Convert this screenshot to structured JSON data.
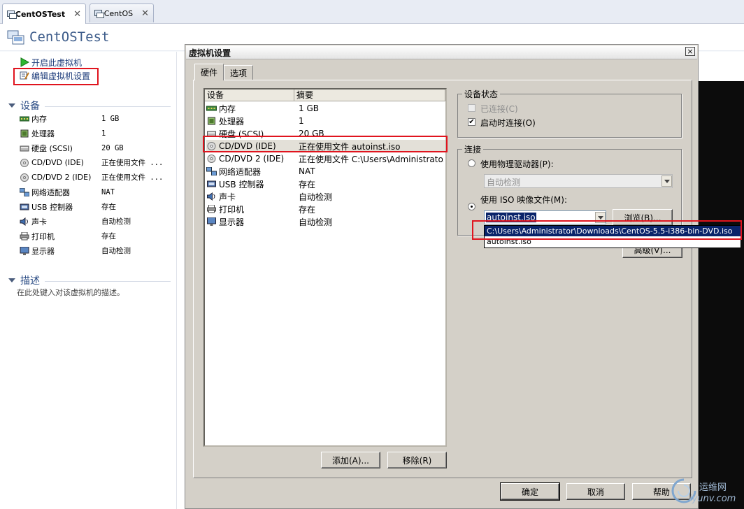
{
  "tabs": [
    {
      "label": "CentOSTest",
      "active": true
    },
    {
      "label": "CentOS",
      "active": false
    }
  ],
  "vm": {
    "title": "CentOSTest",
    "commands": {
      "power_on": "开启此虚拟机",
      "edit_settings": "编辑虚拟机设置"
    }
  },
  "devices_section": {
    "title": "设备",
    "items": [
      {
        "name": "内存",
        "value": "1 GB",
        "icon": "memory-icon"
      },
      {
        "name": "处理器",
        "value": "1",
        "icon": "cpu-icon"
      },
      {
        "name": "硬盘 (SCSI)",
        "value": "20 GB",
        "icon": "harddisk-icon"
      },
      {
        "name": "CD/DVD (IDE)",
        "value": "正在使用文件 ...",
        "icon": "cdrom-icon"
      },
      {
        "name": "CD/DVD 2 (IDE)",
        "value": "正在使用文件 ...",
        "icon": "cdrom-icon"
      },
      {
        "name": "网络适配器",
        "value": "NAT",
        "icon": "network-icon"
      },
      {
        "name": "USB 控制器",
        "value": "存在",
        "icon": "usb-icon"
      },
      {
        "name": "声卡",
        "value": "自动检测",
        "icon": "sound-icon"
      },
      {
        "name": "打印机",
        "value": "存在",
        "icon": "printer-icon"
      },
      {
        "name": "显示器",
        "value": "自动检测",
        "icon": "display-icon"
      }
    ]
  },
  "description_section": {
    "title": "描述",
    "placeholder": "在此处键入对该虚拟机的描述。"
  },
  "dialog": {
    "title": "虚拟机设置",
    "close": "×",
    "tabs": [
      "硬件",
      "选项"
    ],
    "list_headers": {
      "device": "设备",
      "summary": "摘要"
    },
    "devices": [
      {
        "name": "内存",
        "summary": "1 GB"
      },
      {
        "name": "处理器",
        "summary": "1"
      },
      {
        "name": "硬盘 (SCSI)",
        "summary": "20 GB"
      },
      {
        "name": "CD/DVD (IDE)",
        "summary": "正在使用文件 autoinst.iso"
      },
      {
        "name": "CD/DVD 2 (IDE)",
        "summary": "正在使用文件 C:\\Users\\Administrato..."
      },
      {
        "name": "网络适配器",
        "summary": "NAT"
      },
      {
        "name": "USB 控制器",
        "summary": "存在"
      },
      {
        "name": "声卡",
        "summary": "自动检测"
      },
      {
        "name": "打印机",
        "summary": "存在"
      },
      {
        "name": "显示器",
        "summary": "自动检测"
      }
    ],
    "add_button": "添加(A)...",
    "remove_button": "移除(R)",
    "device_status": {
      "title": "设备状态",
      "connected": "已连接(C)",
      "connect_at_power_on": "启动时连接(O)",
      "checkmark": "✔"
    },
    "connection": {
      "title": "连接",
      "physical_drive": "使用物理驱动器(P):",
      "physical_value": "自动检测",
      "iso_file": "使用 ISO 映像文件(M):",
      "iso_value": "autoinst.iso",
      "browse_button": "浏览(B)...",
      "advanced_button": "高级(V)...",
      "dropdown_options": [
        "C:\\Users\\Administrator\\Downloads\\CentOS-5.5-i386-bin-DVD.iso",
        "autoinst.iso"
      ]
    },
    "ok_button": "确定",
    "cancel_button": "取消",
    "help_button": "帮助"
  },
  "watermark": {
    "line1": "运维网",
    "line2": "iyunv.com"
  },
  "colors": {
    "highlight": "#0a246a",
    "annotation_red": "#e0141e",
    "title_blue": "#3d5c8a"
  }
}
